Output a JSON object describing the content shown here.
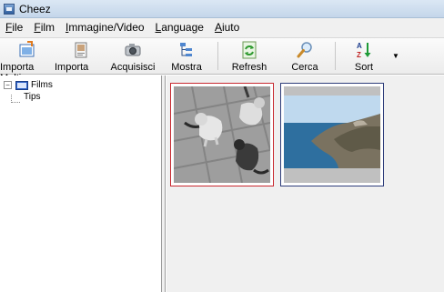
{
  "window": {
    "title": "Cheez"
  },
  "menu": {
    "items": [
      {
        "label": "File",
        "mnemonic": "F",
        "rest": "ile"
      },
      {
        "label": "Film",
        "mnemonic": "F",
        "rest": "ilm"
      },
      {
        "label": "Immagine/Video",
        "mnemonic": "I",
        "rest": "mmagine/Video"
      },
      {
        "label": "Language",
        "mnemonic": "L",
        "rest": "anguage"
      },
      {
        "label": "Aiuto",
        "mnemonic": "A",
        "rest": "iuto"
      }
    ]
  },
  "toolbar": {
    "import_many": "Importa Molti",
    "import_one": "Importa uno",
    "acquire": "Acquisisci",
    "show": "Mostra",
    "refresh": "Refresh",
    "search": "Cerca",
    "sort": "Sort"
  },
  "tree": {
    "root": {
      "label": "Films",
      "expander": "−"
    },
    "children": [
      {
        "label": "Tips"
      }
    ]
  },
  "thumbnails": [
    {
      "name": "cats",
      "selected": true,
      "border_color": "#c8282f"
    },
    {
      "name": "sea",
      "selected": false,
      "border_color": "#2e3d7a"
    }
  ]
}
